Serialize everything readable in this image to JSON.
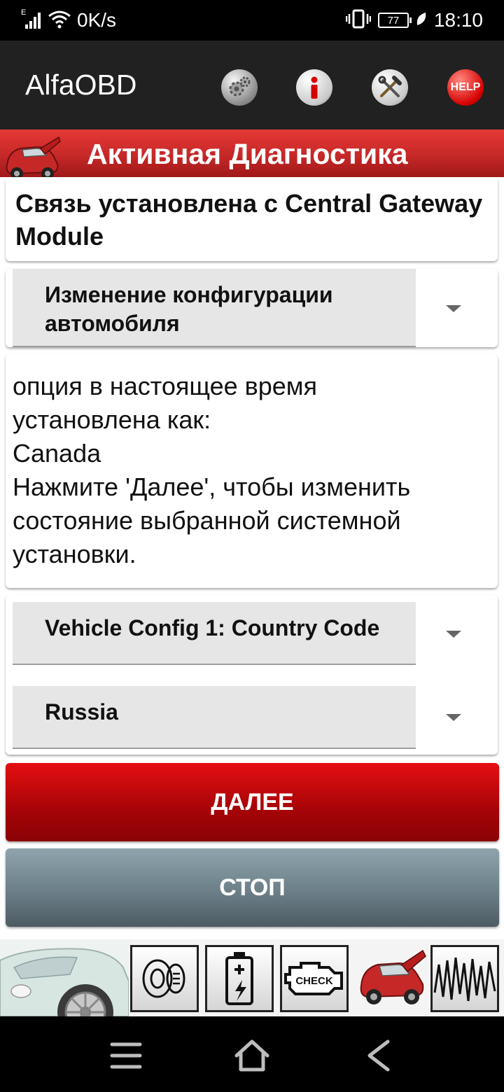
{
  "status_bar": {
    "network_type": "E",
    "net_speed": "0K/s",
    "battery_level": "77",
    "time": "18:10"
  },
  "app_bar": {
    "title": "AlfaOBD",
    "icons": [
      "gear-icon",
      "info-icon",
      "tools-icon",
      "help-icon"
    ],
    "help_label": "HELP"
  },
  "header": {
    "title": "Активная Диагностика"
  },
  "connection": {
    "text": "Связь установлена с Central Gateway Module"
  },
  "function_select": {
    "value": "Изменение конфигурации автомобиля"
  },
  "message": {
    "text": "опция в настоящее время\nустановлена как:\nCanada\nНажмите 'Далее', чтобы изменить состояние выбранной системной установки."
  },
  "parameter_select": {
    "value": "Vehicle Config 1: Country Code"
  },
  "value_select": {
    "value": "Russia"
  },
  "buttons": {
    "next_label": "ДАЛЕЕ",
    "stop_label": "СТОП"
  },
  "tiles": {
    "check_label": "CHECK",
    "icons": [
      "car-banner",
      "key-icon",
      "battery-icon",
      "check-engine-icon",
      "car-hood-icon",
      "waveform-icon"
    ]
  },
  "colors": {
    "accent_red": "#c62828",
    "next_button": "#b30407",
    "stop_button": "#6c7f88",
    "app_bar": "#212121"
  }
}
